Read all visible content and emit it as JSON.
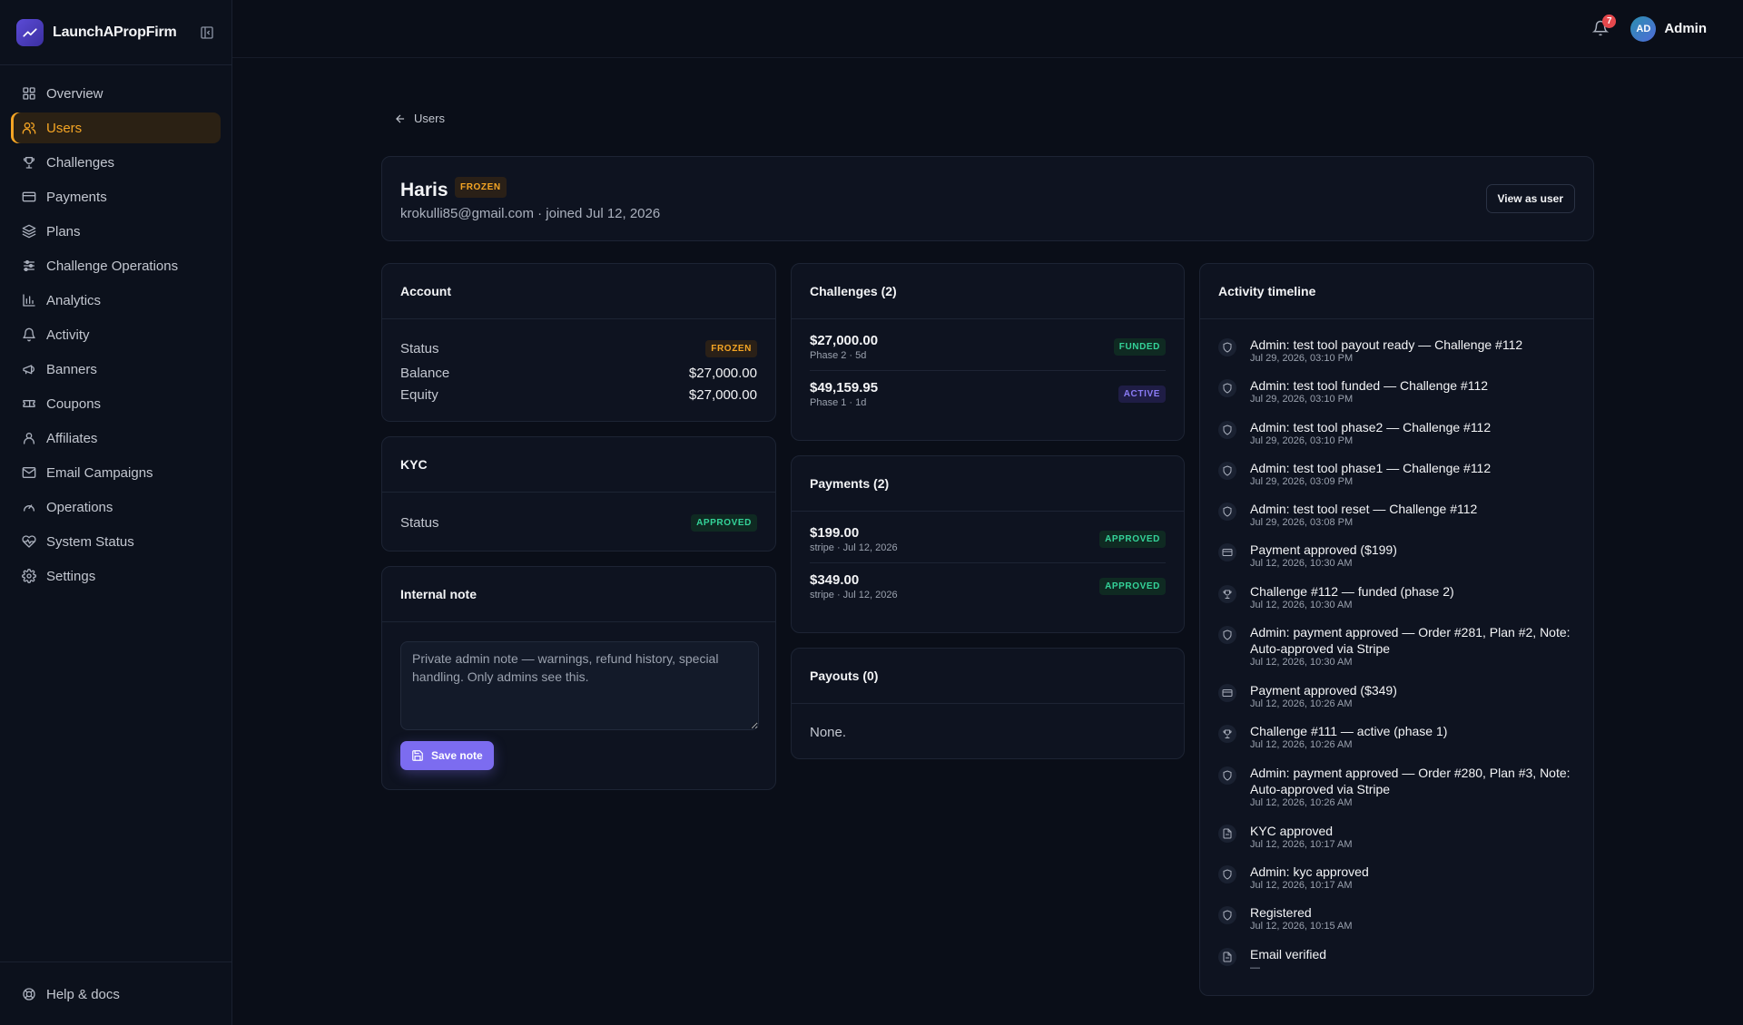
{
  "brand": {
    "name": "LaunchAPropFirm"
  },
  "sidebar": {
    "items": [
      {
        "label": "Overview",
        "icon": "grid-icon"
      },
      {
        "label": "Users",
        "icon": "users-icon",
        "active": true
      },
      {
        "label": "Challenges",
        "icon": "trophy-icon"
      },
      {
        "label": "Payments",
        "icon": "credit-card-icon"
      },
      {
        "label": "Plans",
        "icon": "layers-icon"
      },
      {
        "label": "Challenge Operations",
        "icon": "sliders-icon"
      },
      {
        "label": "Analytics",
        "icon": "bar-chart-icon"
      },
      {
        "label": "Activity",
        "icon": "bell-icon"
      },
      {
        "label": "Banners",
        "icon": "megaphone-icon"
      },
      {
        "label": "Coupons",
        "icon": "ticket-icon"
      },
      {
        "label": "Affiliates",
        "icon": "user-icon"
      },
      {
        "label": "Email Campaigns",
        "icon": "mail-icon"
      },
      {
        "label": "Operations",
        "icon": "gauge-icon"
      },
      {
        "label": "System Status",
        "icon": "heart-pulse-icon"
      },
      {
        "label": "Settings",
        "icon": "gear-icon"
      }
    ],
    "footer_label": "Help & docs"
  },
  "header": {
    "notification_count": "7",
    "avatar_initials": "AD",
    "user_name": "Admin"
  },
  "back": {
    "label": "Users"
  },
  "user": {
    "name": "Haris",
    "status": "FROZEN",
    "meta": "krokulli85@gmail.com · joined Jul 12, 2026",
    "view_as_user": "View as user"
  },
  "account": {
    "title": "Account",
    "status_label": "Status",
    "status_value": "FROZEN",
    "balance_label": "Balance",
    "balance_value": "$27,000.00",
    "equity_label": "Equity",
    "equity_value": "$27,000.00"
  },
  "kyc": {
    "title": "KYC",
    "status_label": "Status",
    "status_value": "APPROVED"
  },
  "note": {
    "title": "Internal note",
    "placeholder": "Private admin note — warnings, refund history, special handling. Only admins see this.",
    "save_label": "Save note"
  },
  "challenges": {
    "title": "Challenges (2)",
    "items": [
      {
        "amount": "$27,000.00",
        "sub": "Phase 2 · 5d",
        "status": "FUNDED"
      },
      {
        "amount": "$49,159.95",
        "sub": "Phase 1 · 1d",
        "status": "ACTIVE"
      }
    ]
  },
  "payments": {
    "title": "Payments (2)",
    "items": [
      {
        "amount": "$199.00",
        "sub": "stripe · Jul 12, 2026",
        "status": "APPROVED"
      },
      {
        "amount": "$349.00",
        "sub": "stripe · Jul 12, 2026",
        "status": "APPROVED"
      }
    ]
  },
  "payouts": {
    "title": "Payouts (0)",
    "empty": "None."
  },
  "timeline": {
    "title": "Activity timeline",
    "items": [
      {
        "icon": "shield-icon",
        "text": "Admin: test tool payout ready — Challenge #112",
        "time": "Jul 29, 2026, 03:10 PM"
      },
      {
        "icon": "shield-icon",
        "text": "Admin: test tool funded — Challenge #112",
        "time": "Jul 29, 2026, 03:10 PM"
      },
      {
        "icon": "shield-icon",
        "text": "Admin: test tool phase2 — Challenge #112",
        "time": "Jul 29, 2026, 03:10 PM"
      },
      {
        "icon": "shield-icon",
        "text": "Admin: test tool phase1 — Challenge #112",
        "time": "Jul 29, 2026, 03:09 PM"
      },
      {
        "icon": "shield-icon",
        "text": "Admin: test tool reset — Challenge #112",
        "time": "Jul 29, 2026, 03:08 PM"
      },
      {
        "icon": "credit-card-icon",
        "text": "Payment approved ($199)",
        "time": "Jul 12, 2026, 10:30 AM"
      },
      {
        "icon": "trophy-icon",
        "text": "Challenge #112 — funded (phase 2)",
        "time": "Jul 12, 2026, 10:30 AM"
      },
      {
        "icon": "shield-icon",
        "text": "Admin: payment approved — Order #281, Plan #2, Note: Auto-approved via Stripe",
        "time": "Jul 12, 2026, 10:30 AM"
      },
      {
        "icon": "credit-card-icon",
        "text": "Payment approved ($349)",
        "time": "Jul 12, 2026, 10:26 AM"
      },
      {
        "icon": "trophy-icon",
        "text": "Challenge #111 — active (phase 1)",
        "time": "Jul 12, 2026, 10:26 AM"
      },
      {
        "icon": "shield-icon",
        "text": "Admin: payment approved — Order #280, Plan #3, Note: Auto-approved via Stripe",
        "time": "Jul 12, 2026, 10:26 AM"
      },
      {
        "icon": "file-icon",
        "text": "KYC approved",
        "time": "Jul 12, 2026, 10:17 AM"
      },
      {
        "icon": "shield-icon",
        "text": "Admin: kyc approved",
        "time": "Jul 12, 2026, 10:17 AM"
      },
      {
        "icon": "shield-icon",
        "text": "Registered",
        "time": "Jul 12, 2026, 10:15 AM"
      },
      {
        "icon": "file-icon",
        "text": "Email verified",
        "time": "—"
      }
    ]
  },
  "colors": {
    "accent": "#f5a524",
    "primary": "#7c6cf0",
    "success": "#34d399",
    "danger": "#e5484d"
  }
}
